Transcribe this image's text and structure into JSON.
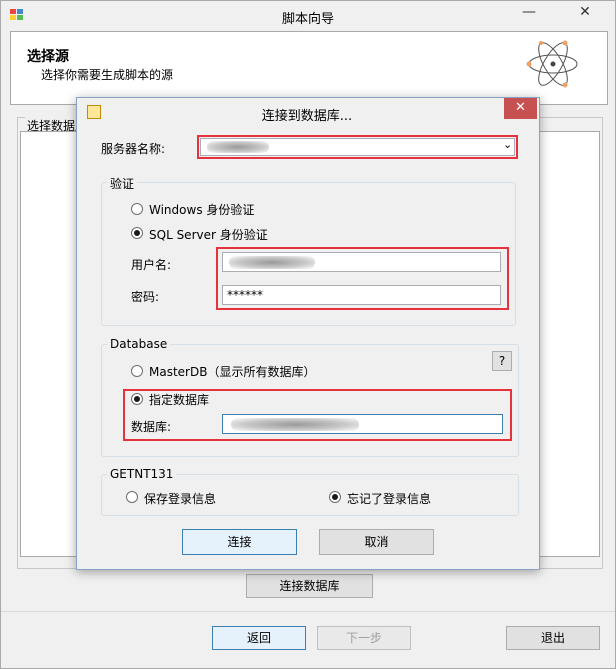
{
  "window": {
    "title": "脚本向导",
    "minimize_glyph": "—",
    "close_glyph": "✕"
  },
  "header": {
    "title": "选择源",
    "subtitle": "选择你需要生成脚本的源"
  },
  "main": {
    "group_label": "选择数据库",
    "connect_db_button": "连接数据库"
  },
  "footer": {
    "back_button": "返回",
    "next_button": "下一步",
    "exit_button": "退出"
  },
  "dialog": {
    "title": "连接到数据库...",
    "close_glyph": "✕",
    "server_label": "服务器名称:",
    "server_value": "",
    "auth_group_label": "验证",
    "windows_auth_label": "Windows 身份验证",
    "sql_auth_label": "SQL Server 身份验证",
    "auth_selected": "sql",
    "username_label": "用户名:",
    "username_value": "",
    "password_label": "密码:",
    "password_value": "******",
    "database_group_label": "Database",
    "masterdb_label": "MasterDB（显示所有数据库）",
    "specify_db_label": "指定数据库",
    "db_selected": "specify",
    "database_label": "数据库:",
    "database_value": "",
    "help_glyph": "?",
    "getnt_group_label": "GETNT131",
    "save_login_label": "保存登录信息",
    "forget_login_label": "忘记了登录信息",
    "login_selected": "forget",
    "connect_button": "连接",
    "cancel_button": "取消"
  },
  "colors": {
    "highlight_red": "#e5323c",
    "close_red": "#c75050",
    "focus_blue": "#3c7fb1"
  }
}
